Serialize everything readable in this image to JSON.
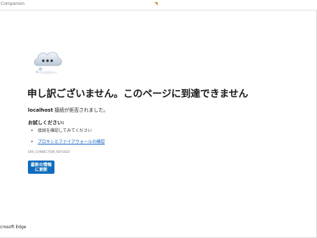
{
  "window": {
    "title": "Companion"
  },
  "error": {
    "headline": "申し訳ございません。このページに到達できません",
    "host": "localhost",
    "message_rest": " 接続が拒否されました。",
    "try_label": "お試しください:",
    "suggestions": [
      {
        "text": "接続を確認してみてください",
        "is_link": false
      },
      {
        "text": "プロキシとファイアウォールの確認",
        "is_link": true
      }
    ],
    "code": "ERR_CONNECTION_REFUSED",
    "refresh_label": "最新の情報に更新"
  },
  "footer": {
    "brand": "crosoft Edge"
  },
  "icons": {
    "cloud": "cloud-with-dots-icon",
    "bullet": "bullet-icon"
  },
  "colors": {
    "accent": "#0f6cbd",
    "link": "#0b61c2"
  }
}
